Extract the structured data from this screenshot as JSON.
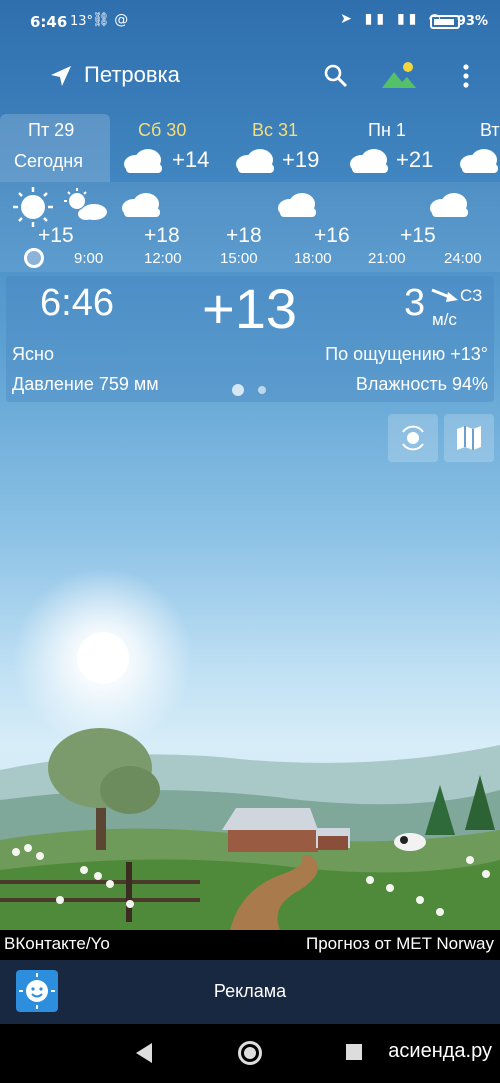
{
  "status_bar": {
    "time": "6:46",
    "temp_small": "13°",
    "battery": "93%"
  },
  "app_bar": {
    "city": "Петровка",
    "icons": [
      "navigation-arrow-icon",
      "search-icon",
      "landscape-icon",
      "more-vert-icon"
    ]
  },
  "days": [
    {
      "name": "Пт 29",
      "sub": "Сегодня"
    },
    {
      "name": "Сб 30",
      "temp": "+14",
      "icon": "cloud-icon"
    },
    {
      "name": "Вс 31",
      "temp": "+19",
      "icon": "cloud-icon"
    },
    {
      "name": "Пн 1",
      "temp": "+21",
      "icon": "cloud-icon"
    },
    {
      "name": "Вт",
      "icon": "cloud-icon"
    }
  ],
  "hourly": [
    {
      "temp": "+15",
      "time": "",
      "icon": "sun-icon"
    },
    {
      "temp": "+18",
      "time": "9:00",
      "icon": "sun-cloud-icon"
    },
    {
      "temp": "+18",
      "time": "12:00",
      "icon": "cloud-icon"
    },
    {
      "temp": "+16",
      "time": "15:00",
      "icon": ""
    },
    {
      "temp": "+15",
      "time": "18:00",
      "icon": "cloud-icon"
    },
    {
      "temp": "",
      "time": "21:00",
      "icon": ""
    },
    {
      "temp": "",
      "time": "24:00",
      "icon": "cloud-icon"
    }
  ],
  "current": {
    "time": "6:46",
    "temp": "+13",
    "wind_speed": "3",
    "wind_unit": "м/с",
    "wind_dir": "СЗ",
    "condition": "Ясно",
    "feels_like": "По ощущению +13°",
    "pressure": "Давление 759 мм",
    "humidity": "Влажность 94%"
  },
  "source": {
    "left": "ВКонтакте/Yo",
    "right": "Прогноз от MET Norway"
  },
  "ad": {
    "label": "Реклама"
  },
  "watermark": "асиенда.ру",
  "colors": {
    "sky_top": "#2f6fae",
    "day_highlight": "#f7dd7a",
    "ad_bar": "#172840"
  }
}
